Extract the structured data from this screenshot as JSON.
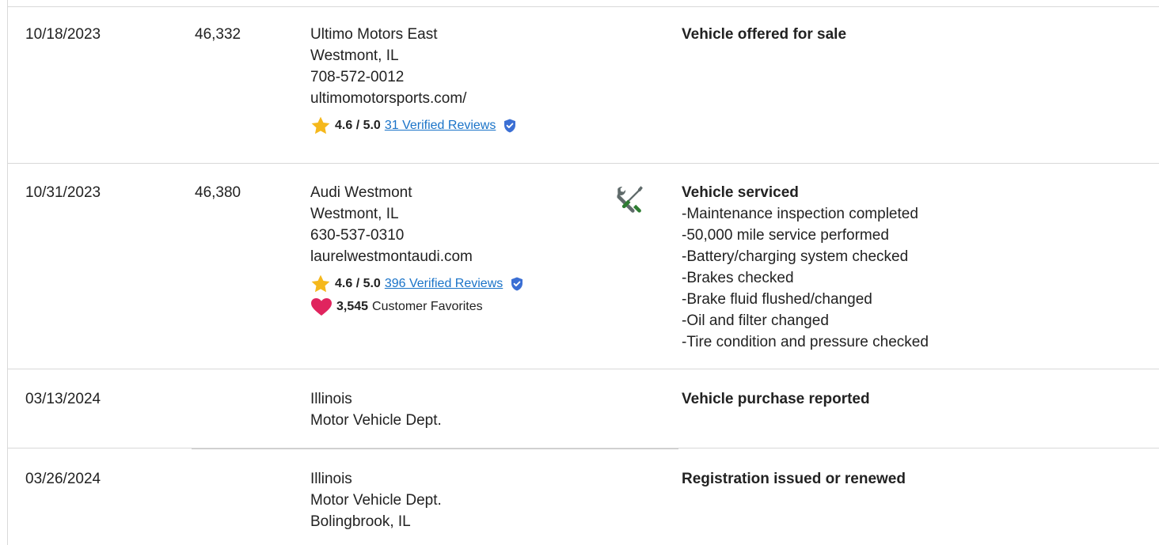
{
  "rows": [
    {
      "date": "10/18/2023",
      "odometer": "46,332",
      "source_lines": [
        "Ultimo Motors East",
        "Westmont, IL",
        "708-572-0012",
        "ultimomotorsports.com/"
      ],
      "rating": {
        "score": "4.6 / 5.0",
        "reviews_link": "31 Verified Reviews"
      },
      "detail_title": "Vehicle offered for sale"
    },
    {
      "date": "10/31/2023",
      "odometer": "46,380",
      "source_lines": [
        "Audi Westmont",
        "Westmont, IL",
        "630-537-0310",
        "laurelwestmontaudi.com"
      ],
      "rating": {
        "score": "4.6 / 5.0",
        "reviews_link": "396 Verified Reviews"
      },
      "favorites": {
        "count": "3,545",
        "label": "Customer Favorites"
      },
      "service_icon": "wrench-screwdriver-icon",
      "detail_title": "Vehicle serviced",
      "detail_items": [
        "Maintenance inspection completed",
        "50,000 mile service performed",
        "Battery/charging system checked",
        "Brakes checked",
        "Brake fluid flushed/changed",
        "Oil and filter changed",
        "Tire condition and pressure checked"
      ]
    },
    {
      "date": "03/13/2024",
      "odometer": "",
      "source_lines": [
        "Illinois",
        "Motor Vehicle Dept."
      ],
      "detail_title": "Vehicle purchase reported"
    },
    {
      "date": "03/26/2024",
      "odometer": "",
      "source_lines": [
        "Illinois",
        "Motor Vehicle Dept.",
        "Bolingbrook, IL"
      ],
      "detail_title": "Registration issued or renewed"
    }
  ],
  "colors": {
    "star": "#f5b81c",
    "link": "#1a73c8",
    "shield": "#3b6fd4",
    "heart": "#e0245e",
    "tool_gray": "#5f6a6a",
    "tool_green": "#2e7d32",
    "divider": "#d9d9d9"
  }
}
